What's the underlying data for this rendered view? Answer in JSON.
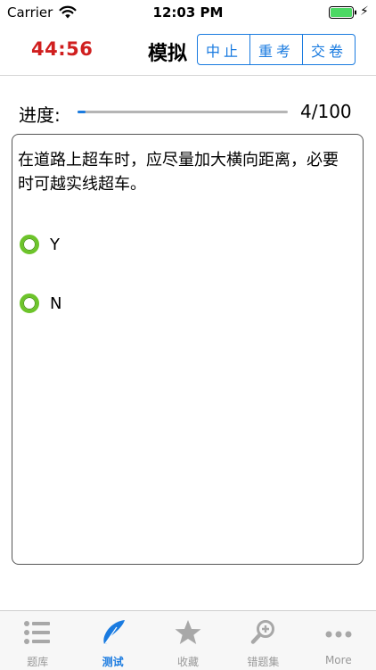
{
  "status_bar": {
    "carrier": "Carrier",
    "time": "12:03 PM"
  },
  "nav": {
    "timer": "44:56",
    "mode": "模拟",
    "buttons": [
      {
        "label": "中止"
      },
      {
        "label": "重考"
      },
      {
        "label": "交卷"
      }
    ]
  },
  "progress": {
    "label": "进度:",
    "count": "4/100",
    "current": 4,
    "total": 100
  },
  "question": {
    "text": "在道路上超车时，应尽量加大横向距离，必要时可越实线超车。",
    "options": [
      {
        "label": "Y"
      },
      {
        "label": "N"
      }
    ]
  },
  "tabs": [
    {
      "label": "题库",
      "icon": "list-icon"
    },
    {
      "label": "测试",
      "icon": "feather-icon",
      "active": true
    },
    {
      "label": "收藏",
      "icon": "star-icon"
    },
    {
      "label": "错题集",
      "icon": "magnifier-icon"
    },
    {
      "label": "More",
      "icon": "more-icon"
    }
  ],
  "colors": {
    "accent": "#1a7be0",
    "timer": "#d01f1f",
    "radio": "#6dc42a",
    "battery": "#4cd964"
  }
}
